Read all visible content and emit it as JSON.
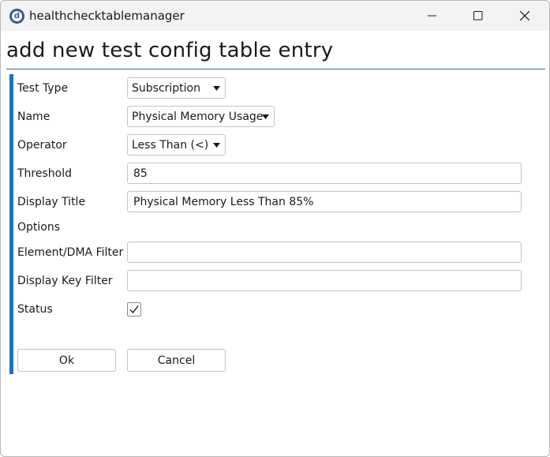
{
  "window": {
    "title": "healthchecktablemanager",
    "icon": "app-logo-icon",
    "icon_letter": "d",
    "controls": [
      "minimize-icon",
      "maximize-icon",
      "close-icon"
    ]
  },
  "form": {
    "heading": "add new test config table entry",
    "fields": {
      "test_type": {
        "label": "Test Type",
        "value": "Subscription"
      },
      "name": {
        "label": "Name",
        "value": "Physical Memory Usage"
      },
      "operator": {
        "label": "Operator",
        "value": "Less Than (<)"
      },
      "threshold": {
        "label": "Threshold",
        "value": "85"
      },
      "display_title": {
        "label": "Display Title",
        "value": "Physical Memory Less Than 85%"
      },
      "options": {
        "label": "Options"
      },
      "element_filter": {
        "label": "Element/DMA Filter",
        "value": ""
      },
      "display_key_filter": {
        "label": "Display Key Filter",
        "value": ""
      },
      "status": {
        "label": "Status",
        "checked": true
      }
    },
    "buttons": {
      "ok": "Ok",
      "cancel": "Cancel"
    }
  },
  "colors": {
    "accent": "#1e73be",
    "heading_rule": "#2a6f9b",
    "titlebar": "#f3f3f3"
  }
}
